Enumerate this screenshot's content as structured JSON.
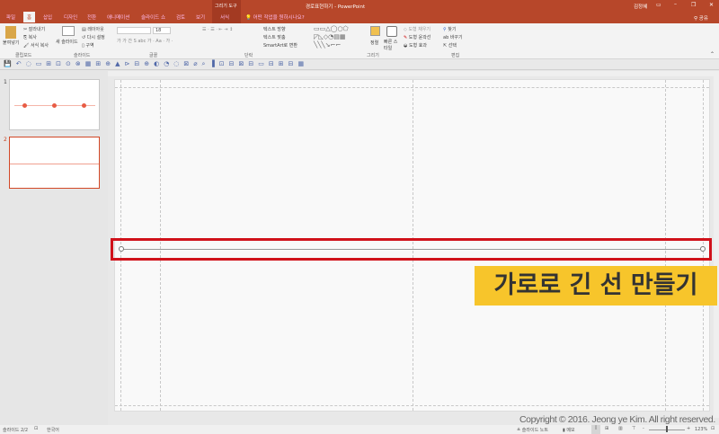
{
  "window": {
    "title": "경로표현하기 - PowerPoint",
    "user": "김정혜",
    "share": "공유",
    "context_group": "그리기 도구"
  },
  "tabs": [
    "파일",
    "홈",
    "삽입",
    "디자인",
    "전환",
    "애니메이션",
    "슬라이드 쇼",
    "검토",
    "보기",
    "서식"
  ],
  "tell_me": "어떤 작업을 원하시나요?",
  "ribbon": {
    "clipboard": {
      "paste": "붙여넣기",
      "cut": "잘라내기",
      "copy": "복사",
      "format_painter": "서식 복사",
      "label": "클립보드"
    },
    "slides": {
      "new_slide": "새 슬라이드",
      "layout": "레이아웃",
      "reset": "다시 설정",
      "section": "구역",
      "label": "슬라이드"
    },
    "font": {
      "size": "18",
      "label": "글꼴"
    },
    "paragraph": {
      "text_direction": "텍스트 방향",
      "align_text": "텍스트 맞춤",
      "smartart": "SmartArt로 변환",
      "label": "단락"
    },
    "drawing": {
      "arrange": "정렬",
      "quick_styles": "빠른 스타일",
      "shape_fill": "도형 채우기",
      "shape_outline": "도형 윤곽선",
      "shape_effects": "도형 효과",
      "label": "그리기"
    },
    "editing": {
      "find": "찾기",
      "replace": "바꾸기",
      "select": "선택",
      "label": "편집"
    }
  },
  "slides": [
    {
      "number": "1"
    },
    {
      "number": "2",
      "selected": true
    }
  ],
  "overlay": {
    "caption": "가로로 긴 선 만들기",
    "copyright": "Copyright © 2016. Jeong ye Kim. All right reserved.",
    "accent": "#f7c52b",
    "highlight": "#d0121b"
  },
  "status": {
    "slide": "슬라이드 2/2",
    "language": "한국어",
    "notes": "슬라이드 노트",
    "comments": "메모",
    "zoom": "123%"
  }
}
